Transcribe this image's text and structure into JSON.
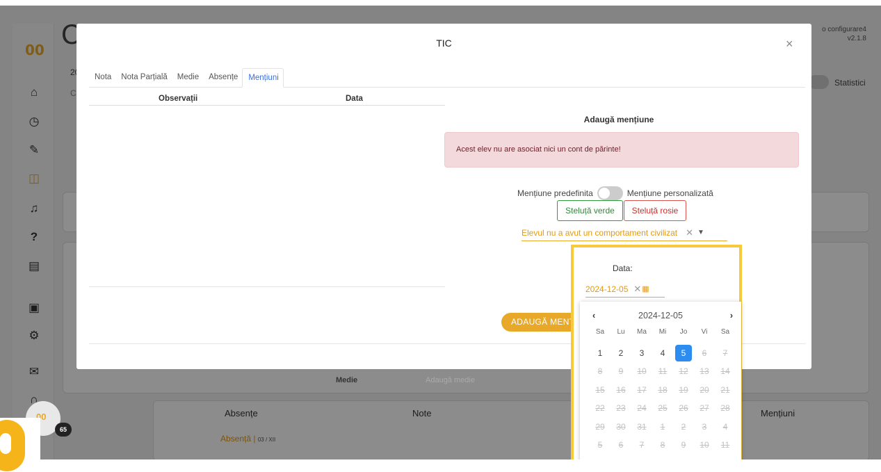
{
  "app": {
    "badge_count": "65",
    "version_line1": "o configurare4",
    "version_line2": "v2.1.8",
    "page_letter": "C",
    "stats_label": "Statistici"
  },
  "sidebar": {
    "icons": [
      "home-icon",
      "clock-icon",
      "pencil-icon",
      "book-icon",
      "bell-icon",
      "question-icon",
      "document-icon",
      "contact-icon",
      "settings-icon",
      "mail-icon",
      "headset-icon"
    ]
  },
  "background": {
    "medie_label": "Medie",
    "medie_placeholder": "Adaugă medie",
    "absente_header": "Absențe",
    "note_header": "Note",
    "mentiuni_header": "Mențiuni",
    "absenta_text": "Absență",
    "absenta_date": "03 / XII",
    "bg_row_partial1": "20",
    "bg_row_partial2": "C"
  },
  "modal": {
    "title": "TIC",
    "tabs": [
      "Nota",
      "Nota Parțială",
      "Medie",
      "Absențe",
      "Mențiuni"
    ],
    "active_tab": "Mențiuni",
    "columns": {
      "observatii": "Observații",
      "data": "Data"
    },
    "add_title": "Adaugă mențiune",
    "alert": "Acest elev nu are asociat nici un cont de părinte!",
    "toggle_left": "Mențiune predefinita",
    "toggle_right": "Mențiune personalizată",
    "btn_green": "Steluță verde",
    "btn_red": "Steluță rosie",
    "select_value": "Elevul nu a avut un comportament civilizat",
    "add_button": "ADAUGĂ MENȚIUNE"
  },
  "datepicker": {
    "label": "Data:",
    "value": "2024-12-05",
    "month_label": "2024-12-05",
    "dow": [
      "Sa",
      "Lu",
      "Ma",
      "Mi",
      "Jo",
      "Vi",
      "Sa"
    ],
    "weeks": [
      [
        "1",
        "2",
        "3",
        "4",
        "5",
        "6",
        "7"
      ],
      [
        "8",
        "9",
        "10",
        "11",
        "12",
        "13",
        "14"
      ],
      [
        "15",
        "16",
        "17",
        "18",
        "19",
        "20",
        "21"
      ],
      [
        "22",
        "23",
        "24",
        "25",
        "26",
        "27",
        "28"
      ],
      [
        "29",
        "30",
        "31",
        "1",
        "2",
        "3",
        "4"
      ],
      [
        "5",
        "6",
        "7",
        "8",
        "9",
        "10",
        "11"
      ]
    ],
    "selected": "5",
    "enabled_count": 5,
    "highlight_color": "#f9c93c"
  }
}
